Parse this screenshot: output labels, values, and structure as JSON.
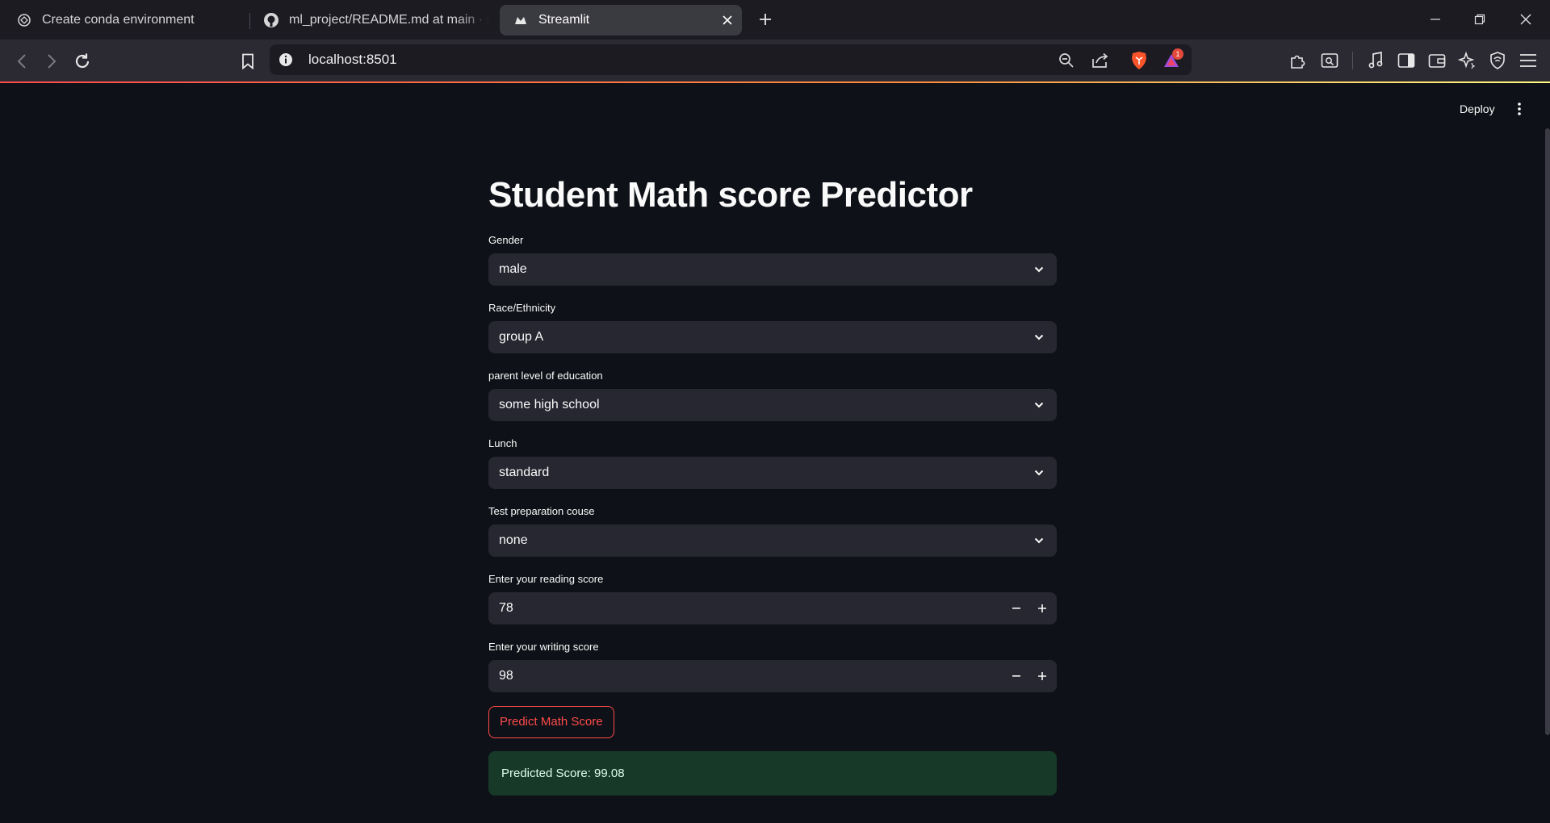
{
  "browser": {
    "tabs": [
      {
        "title": "Create conda environment",
        "icon": "chatgpt-icon"
      },
      {
        "title": "ml_project/README.md at main · srid",
        "icon": "github-icon"
      },
      {
        "title": "Streamlit",
        "icon": "streamlit-icon",
        "active": true
      }
    ],
    "url": "localhost:8501",
    "notification_count": "1"
  },
  "app": {
    "header": {
      "deploy_label": "Deploy"
    },
    "title": "Student Math score Predictor",
    "fields": {
      "gender": {
        "label": "Gender",
        "value": "male"
      },
      "race": {
        "label": "Race/Ethnicity",
        "value": "group A"
      },
      "parent_education": {
        "label": "parent level of education",
        "value": "some high school"
      },
      "lunch": {
        "label": "Lunch",
        "value": "standard"
      },
      "test_prep": {
        "label": "Test preparation couse",
        "value": "none"
      },
      "reading": {
        "label": "Enter your reading score",
        "value": "78"
      },
      "writing": {
        "label": "Enter your writing score",
        "value": "98"
      }
    },
    "predict_button": "Predict Math Score",
    "result": "Predicted Score: 99.08",
    "colors": {
      "background": "#0e1117",
      "widget": "#262730",
      "primary": "#ff4b4b",
      "success_bg": "#173928"
    }
  }
}
